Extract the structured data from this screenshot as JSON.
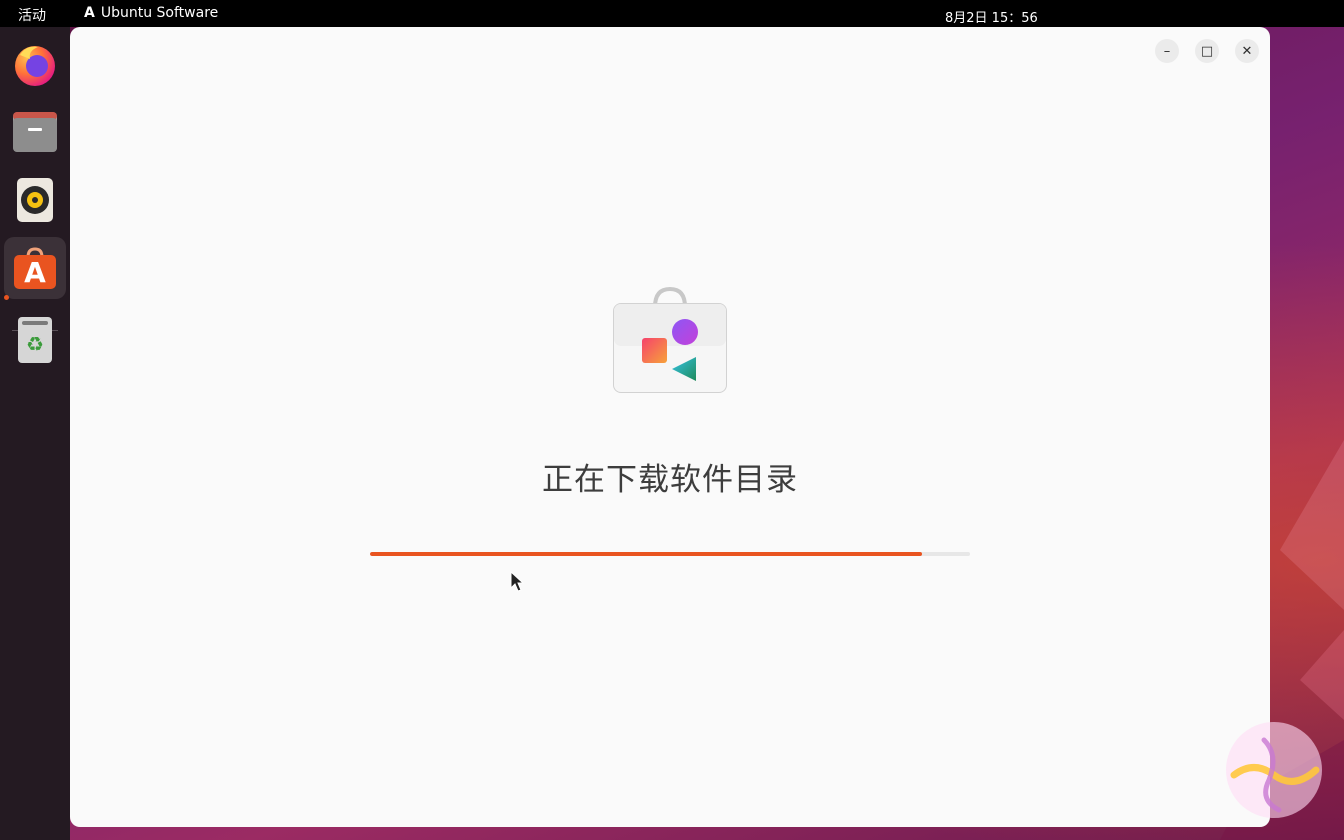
{
  "topbar": {
    "activities": "活动",
    "app_name": "Ubuntu Software",
    "app_glyph": "A",
    "clock": "8月2日  15：56"
  },
  "dock": {
    "items": [
      {
        "name": "firefox",
        "icon": "firefox-icon"
      },
      {
        "name": "files",
        "icon": "files-icon"
      },
      {
        "name": "rhythmbox",
        "icon": "rhythmbox-icon"
      },
      {
        "name": "ubuntu-software",
        "icon": "ubuntu-software-icon",
        "active": true
      },
      {
        "name": "trash",
        "icon": "trash-icon"
      }
    ],
    "software_glyph": "A",
    "trash_glyph": "♻"
  },
  "window": {
    "controls": {
      "minimize": "–",
      "maximize": "□",
      "close": "✕"
    },
    "loading_text": "正在下载软件目录",
    "progress_fraction": 0.92
  },
  "colors": {
    "accent": "#e95420",
    "window_bg": "#fafafa",
    "topbar_bg": "#000000",
    "dock_bg": "#241a22"
  }
}
